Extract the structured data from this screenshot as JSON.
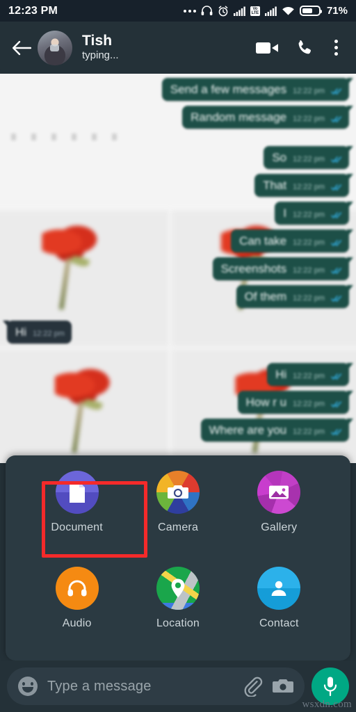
{
  "status_bar": {
    "time": "12:23 PM",
    "battery_percent": "71%",
    "icons": [
      "more-icon",
      "headphones-icon",
      "alarm-icon",
      "signal-icon",
      "volte-icon",
      "signal-icon",
      "wifi-icon",
      "battery-icon"
    ],
    "volte_top": "Vo",
    "volte_bottom": "LTE"
  },
  "app_bar": {
    "back_label": "back-arrow",
    "contact_name": "Tish",
    "contact_status": "typing...",
    "video_call_label": "video-call",
    "voice_call_label": "voice-call",
    "menu_label": "more-options"
  },
  "chat": {
    "messages": [
      {
        "text": "Send a few messages",
        "time": "12:22 pm",
        "direction": "out",
        "status": "read"
      },
      {
        "text": "Random message",
        "time": "12:22 pm",
        "direction": "out",
        "status": "read"
      },
      {
        "text": "So",
        "time": "12:22 pm",
        "direction": "out",
        "status": "read"
      },
      {
        "text": "That",
        "time": "12:22 pm",
        "direction": "out",
        "status": "read"
      },
      {
        "text": "I",
        "time": "12:22 pm",
        "direction": "out",
        "status": "read"
      },
      {
        "text": "Can take",
        "time": "12:22 pm",
        "direction": "out",
        "status": "read"
      },
      {
        "text": "Screenshots",
        "time": "12:22 pm",
        "direction": "out",
        "status": "read"
      },
      {
        "text": "Of them",
        "time": "12:22 pm",
        "direction": "out",
        "status": "read"
      },
      {
        "text": "Hi",
        "time": "12:22 pm",
        "direction": "in",
        "status": "none"
      },
      {
        "text": "Hi",
        "time": "12:22 pm",
        "direction": "out",
        "status": "read"
      },
      {
        "text": "How r u",
        "time": "12:22 pm",
        "direction": "out",
        "status": "read"
      },
      {
        "text": "Where are you",
        "time": "12:22 pm",
        "direction": "out",
        "status": "read"
      }
    ]
  },
  "attachment_panel": {
    "items": [
      {
        "label": "Document",
        "icon": "document-icon",
        "color": "#5b55d6",
        "highlighted": true
      },
      {
        "label": "Camera",
        "icon": "camera-icon",
        "color": "#e8802a",
        "highlighted": false
      },
      {
        "label": "Gallery",
        "icon": "gallery-icon",
        "color": "#c13fc6",
        "highlighted": false
      },
      {
        "label": "Audio",
        "icon": "audio-icon",
        "color": "#f79a1e",
        "highlighted": false
      },
      {
        "label": "Location",
        "icon": "location-icon",
        "color": "#1aa64b",
        "highlighted": false
      },
      {
        "label": "Contact",
        "icon": "contact-icon",
        "color": "#17a9e8",
        "highlighted": false
      }
    ],
    "highlight_color": "#f42a2a"
  },
  "input_bar": {
    "placeholder": "Type a message",
    "value": "",
    "emoji_label": "emoji",
    "attach_label": "attach",
    "camera_label": "camera",
    "mic_label": "voice-record",
    "mic_color": "#00a884"
  },
  "watermark": {
    "text": "wsxdn.com"
  }
}
